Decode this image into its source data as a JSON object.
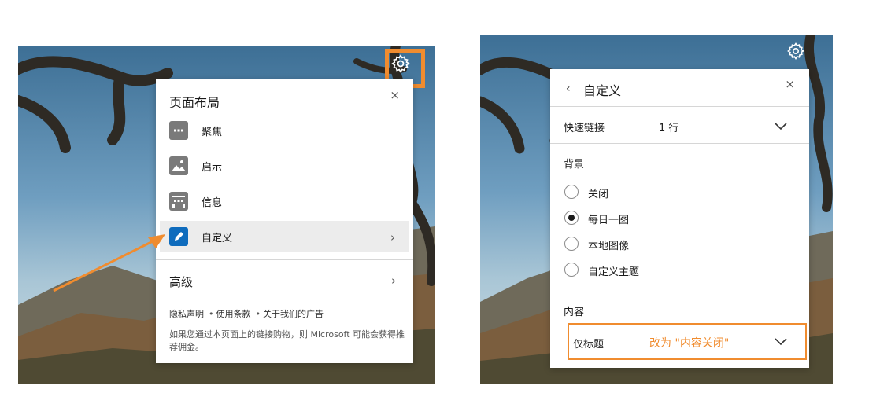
{
  "left_panel": {
    "title": "页面布局",
    "close_label": "×",
    "menu": [
      {
        "label": "聚焦",
        "icon": "focus-layout-icon"
      },
      {
        "label": "启示",
        "icon": "inspiration-layout-icon"
      },
      {
        "label": "信息",
        "icon": "informational-layout-icon"
      },
      {
        "label": "自定义",
        "icon": "custom-pencil-icon"
      }
    ],
    "chevron": "›",
    "advanced_label": "高级",
    "links": [
      "隐私声明",
      "使用条款",
      "关于我们的广告"
    ],
    "link_separator": "•",
    "disclaimer": "如果您通过本页面上的链接购物，则 Microsoft 可能会获得推荐佣金。"
  },
  "right_panel": {
    "back_label": "‹",
    "title": "自定义",
    "close_label": "×",
    "quick_links": {
      "label": "快速链接",
      "value": "1 行"
    },
    "background": {
      "heading": "背景",
      "options": [
        "关闭",
        "每日一图",
        "本地图像",
        "自定义主题"
      ],
      "selected_index": 1
    },
    "content": {
      "heading": "内容",
      "value": "仅标题",
      "annotation": "改为 \"内容关闭\""
    }
  },
  "colors": {
    "highlight": "#f08c2f",
    "accent": "#0f6cbd",
    "active_row": "#ececec"
  },
  "icons": [
    "gear-icon",
    "close-icon",
    "chevron-right-icon",
    "chevron-down-icon",
    "back-chevron-icon",
    "annotation-arrow"
  ]
}
